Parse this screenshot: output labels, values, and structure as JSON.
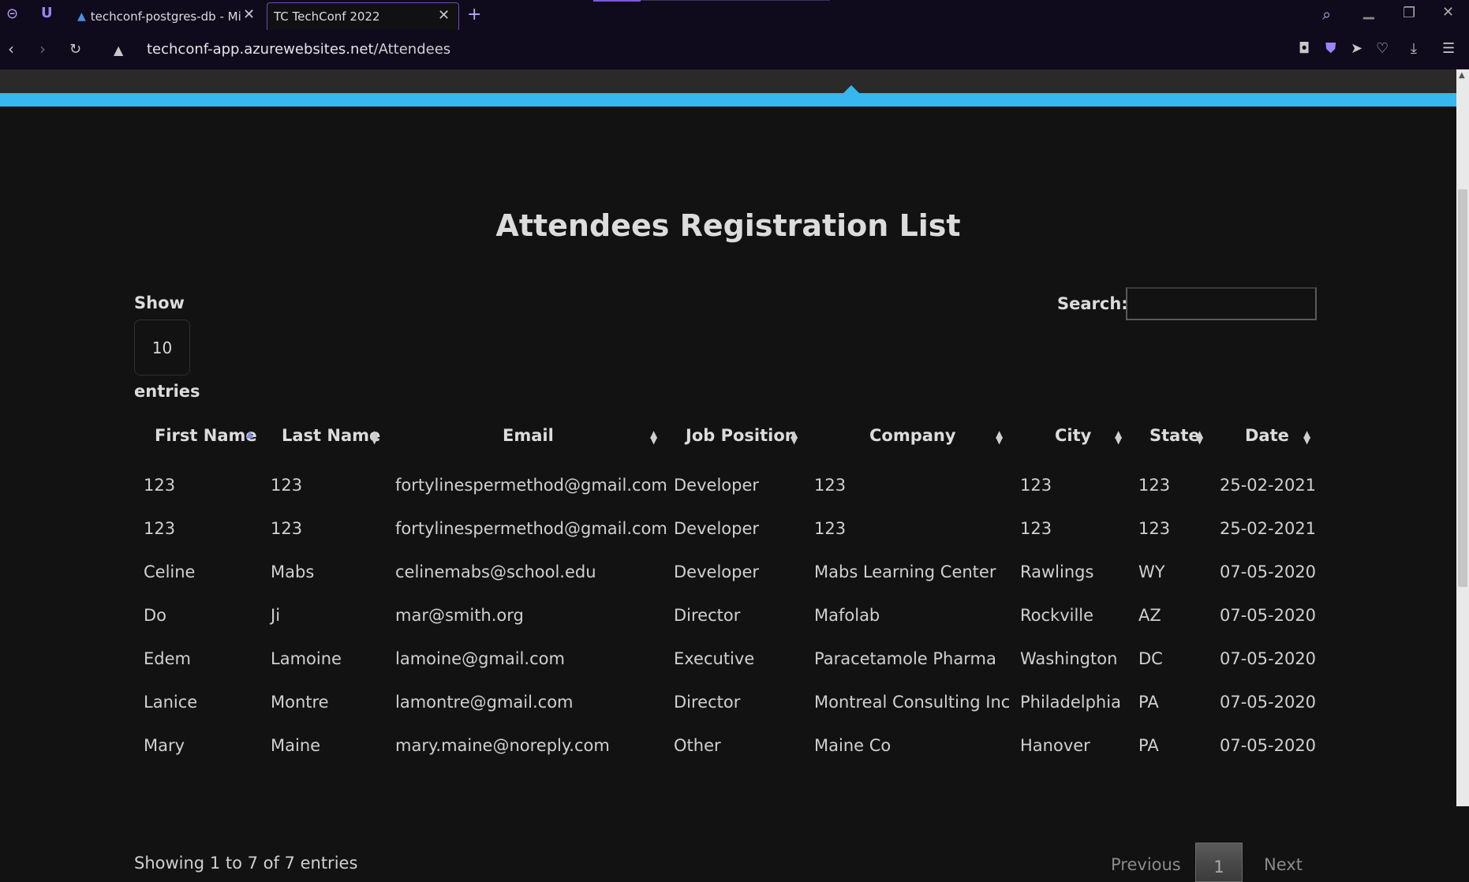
{
  "browser": {
    "tabs": [
      {
        "label": "techconf-postgres-db - Mi",
        "active": false
      },
      {
        "label": "TC TechConf 2022",
        "active": true
      }
    ],
    "url_host": "techconf-app.azurewebsites.net",
    "url_path": "/Attendees"
  },
  "page": {
    "title": "Attendees Registration List",
    "show_label": "Show",
    "page_length": "10",
    "entries_label": "entries",
    "search_label": "Search:",
    "search_value": ""
  },
  "table": {
    "columns": [
      "First Name",
      "Last Name",
      "Email",
      "Job Position",
      "Company",
      "City",
      "State",
      "Date"
    ],
    "rows": [
      [
        "123",
        "123",
        "fortylinespermethod@gmail.com",
        "Developer",
        "123",
        "123",
        "123",
        "25-02-2021"
      ],
      [
        "123",
        "123",
        "fortylinespermethod@gmail.com",
        "Developer",
        "123",
        "123",
        "123",
        "25-02-2021"
      ],
      [
        "Celine",
        "Mabs",
        "celinemabs@school.edu",
        "Developer",
        "Mabs Learning Center",
        "Rawlings",
        "WY",
        "07-05-2020"
      ],
      [
        "Do",
        "Ji",
        "mar@smith.org",
        "Director",
        "Mafolab",
        "Rockville",
        "AZ",
        "07-05-2020"
      ],
      [
        "Edem",
        "Lamoine",
        "lamoine@gmail.com",
        "Executive",
        "Paracetamole Pharma",
        "Washington",
        "DC",
        "07-05-2020"
      ],
      [
        "Lanice",
        "Montre",
        "lamontre@gmail.com",
        "Director",
        "Montreal Consulting Inc",
        "Philadelphia",
        "PA",
        "07-05-2020"
      ],
      [
        "Mary",
        "Maine",
        "mary.maine@noreply.com",
        "Other",
        "Maine Co",
        "Hanover",
        "PA",
        "07-05-2020"
      ]
    ]
  },
  "footer": {
    "info": "Showing 1 to 7 of 7 entries",
    "previous": "Previous",
    "current_page": "1",
    "next": "Next"
  },
  "colors": {
    "accent_blue": "#36b7ef",
    "background": "#121212",
    "browser_chrome": "#0f0a1c",
    "tab_accent": "#7a5bd6"
  }
}
